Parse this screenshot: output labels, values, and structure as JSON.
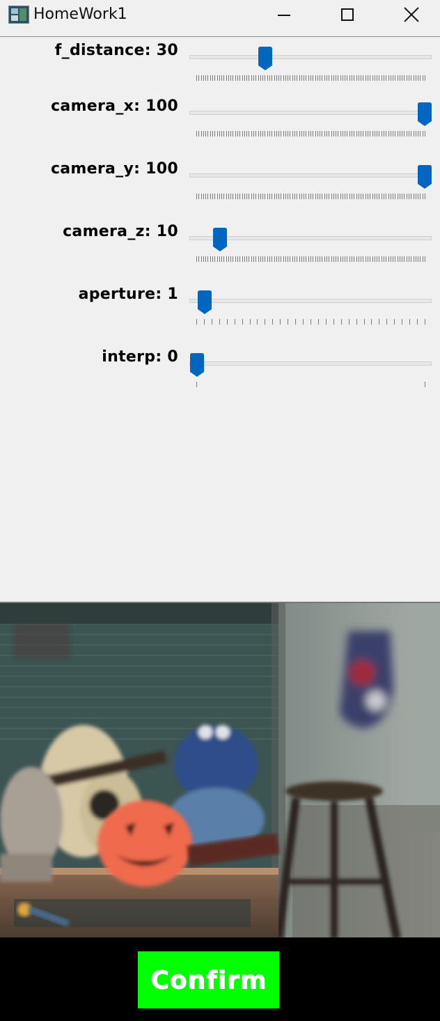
{
  "window": {
    "title": "HomeWork1",
    "controls": [
      "minimize",
      "maximize",
      "close"
    ]
  },
  "trackbars": [
    {
      "name": "f_distance",
      "label": "f_distance: 30",
      "value": 30,
      "min": 0,
      "max": 100,
      "tick_count": 101
    },
    {
      "name": "camera_x",
      "label": "camera_x: 100",
      "value": 100,
      "min": 0,
      "max": 100,
      "tick_count": 101
    },
    {
      "name": "camera_y",
      "label": "camera_y: 100",
      "value": 100,
      "min": 0,
      "max": 100,
      "tick_count": 101
    },
    {
      "name": "camera_z",
      "label": "camera_z: 10",
      "value": 10,
      "min": 0,
      "max": 100,
      "tick_count": 101
    },
    {
      "name": "aperture",
      "label": "aperture: 1",
      "value": 1,
      "min": 0,
      "max": 30,
      "tick_count": 31
    },
    {
      "name": "interp",
      "label": "interp: 0",
      "value": 0,
      "min": 0,
      "max": 1,
      "tick_count": 2
    }
  ],
  "image": {
    "description_icon": "rendered-scene-image"
  },
  "confirm": {
    "label": "Confirm"
  },
  "colors": {
    "thumb": "#0067c0",
    "confirm_bg": "#00ff00",
    "confirm_text": "#ffffff"
  }
}
